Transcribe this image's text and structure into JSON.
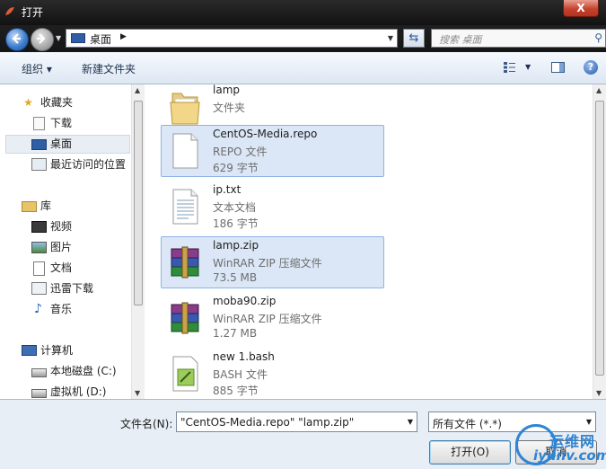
{
  "window": {
    "title": "打开",
    "close_label": "X"
  },
  "address": {
    "crumb": "桌面",
    "search_placeholder": "搜索 桌面"
  },
  "toolbar": {
    "organize": "组织 ▾",
    "new_folder": "新建文件夹",
    "help": "?"
  },
  "sidebar": {
    "items": [
      {
        "label": "收藏夹",
        "icon": "star-icon"
      },
      {
        "label": "下载",
        "icon": "download-folder-icon"
      },
      {
        "label": "桌面",
        "icon": "desktop-icon"
      },
      {
        "label": "最近访问的位置",
        "icon": "recent-places-icon"
      },
      {
        "label": "库",
        "icon": "library-icon"
      },
      {
        "label": "视频",
        "icon": "video-icon"
      },
      {
        "label": "图片",
        "icon": "picture-icon"
      },
      {
        "label": "文档",
        "icon": "document-icon"
      },
      {
        "label": "迅雷下载",
        "icon": "thunder-download-icon"
      },
      {
        "label": "音乐",
        "icon": "music-icon"
      },
      {
        "label": "计算机",
        "icon": "computer-icon"
      },
      {
        "label": "本地磁盘 (C:)",
        "icon": "local-disk-icon"
      },
      {
        "label": "虚拟机 (D:)",
        "icon": "drive-icon"
      }
    ],
    "selected": "桌面"
  },
  "files": [
    {
      "name": "lamp",
      "type": "文件夹",
      "size": "",
      "icon": "folder-icon",
      "selected": false
    },
    {
      "name": "CentOS-Media.repo",
      "type": "REPO 文件",
      "size": "629 字节",
      "icon": "blank-file-icon",
      "selected": true
    },
    {
      "name": "ip.txt",
      "type": "文本文档",
      "size": "186 字节",
      "icon": "text-file-icon",
      "selected": false
    },
    {
      "name": "lamp.zip",
      "type": "WinRAR ZIP 压缩文件",
      "size": "73.5 MB",
      "icon": "winrar-archive-icon",
      "selected": true
    },
    {
      "name": "moba90.zip",
      "type": "WinRAR ZIP 压缩文件",
      "size": "1.27 MB",
      "icon": "winrar-archive-icon",
      "selected": false
    },
    {
      "name": "new 1.bash",
      "type": "BASH 文件",
      "size": "885 字节",
      "icon": "bash-file-icon",
      "selected": false
    }
  ],
  "bottom": {
    "filename_label": "文件名(N):",
    "filename_value": "\"CentOS-Media.repo\" \"lamp.zip\"",
    "filter_value": "所有文件 (*.*)",
    "open_label": "打开(O)",
    "cancel_label": "取消"
  },
  "watermark": {
    "cn": "运维网",
    "en": "iyunv.com"
  },
  "colors": {
    "selection": "#dbe7f6",
    "selection_border": "#8fb2e0",
    "title_bar": "#1b1b1b",
    "close_red": "#c4432e"
  }
}
